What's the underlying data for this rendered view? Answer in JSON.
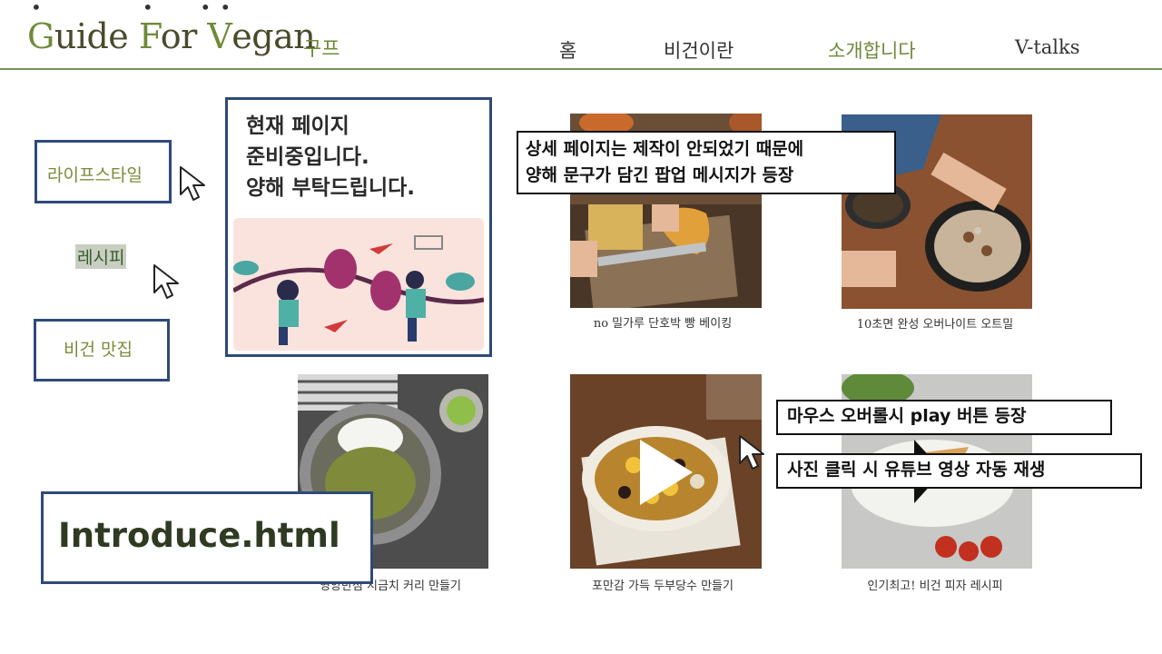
{
  "header": {
    "logo": {
      "g": "G",
      "rest1": "uide ",
      "f": "F",
      "rest2": "or ",
      "v": "V",
      "rest3": "egan"
    },
    "logo_sub": "구프",
    "nav": [
      {
        "label": "홈"
      },
      {
        "label": "비건이란"
      },
      {
        "label": "소개합니다",
        "active": true
      },
      {
        "label": "V-talks"
      }
    ]
  },
  "sidebar": {
    "items": [
      {
        "label": "라이프스타일"
      },
      {
        "label": "레시피",
        "highlighted": true
      },
      {
        "label": "비건 맛집"
      }
    ]
  },
  "popup": {
    "message": "현재 페이지\n준비중입니다.\n양해 부탁드립니다."
  },
  "cards": [
    {
      "caption": "no 밀가루 단호박 빵 베이킹"
    },
    {
      "caption": "10초면 완성 오버나이트 오트밀"
    },
    {
      "caption": "영양만점 시금치 커리 만들기"
    },
    {
      "caption": "포만감 가득 두부당수 만들기"
    },
    {
      "caption": "인기최고! 비건 피자 레시피"
    }
  ],
  "annotations": {
    "detail_note": "상세 페이지는 제작이 안되었기 때문에\n양해 문구가 담긴 팝업 메시지가 등장",
    "hover_note": "마우스 오버롤시 play 버튼 등장",
    "click_note": "사진 클릭 시 유튜브 영상 자동 재생",
    "file_label": "Introduce.html"
  },
  "colors": {
    "accent": "#6f8a3a",
    "border": "#2e4a78",
    "line": "#7a8f5a"
  }
}
